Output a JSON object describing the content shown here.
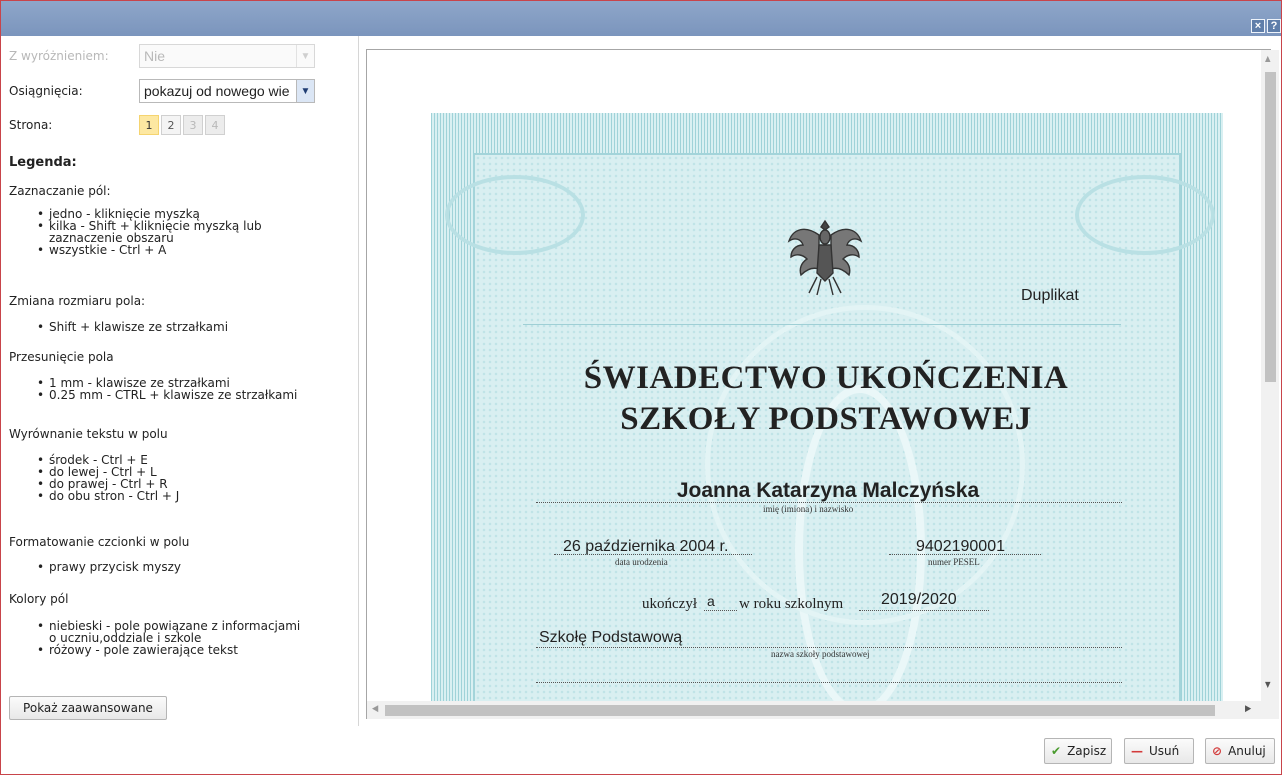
{
  "window": {
    "close_label": "×",
    "help_label": "?"
  },
  "form": {
    "wyroznienie": {
      "label": "Z wyróżnieniem:",
      "value": "Nie"
    },
    "osiagniecia": {
      "label": "Osiągnięcia:",
      "value": "pokazuj od nowego wie"
    },
    "strona": {
      "label": "Strona:",
      "pages": [
        "1",
        "2",
        "3",
        "4"
      ],
      "active_page": "1"
    }
  },
  "legend": {
    "title": "Legenda:",
    "sections": [
      {
        "heading": "Zaznaczanie pól:",
        "items": [
          "jedno - kliknięcie myszką",
          "kilka - Shift + kliknięcie myszką lub",
          "zaznaczenie obszaru",
          "wszystkie - Ctrl + A"
        ]
      },
      {
        "heading": "Zmiana rozmiaru pola:",
        "items": [
          "Shift + klawisze ze strzałkami"
        ]
      },
      {
        "heading": "Przesunięcie pola",
        "items": [
          "1 mm - klawisze ze strzałkami",
          "0.25 mm - CTRL + klawisze ze strzałkami"
        ]
      },
      {
        "heading": "Wyrównanie tekstu w polu",
        "items": [
          "środek - Ctrl + E",
          "do lewej - Ctrl + L",
          "do prawej - Ctrl + R",
          "do obu stron - Ctrl + J"
        ]
      },
      {
        "heading": "Formatowanie czcionki w polu",
        "items": [
          "prawy przycisk myszy"
        ]
      },
      {
        "heading": "Kolory pól",
        "items": [
          "niebieski - pole powiązane z informacjami",
          "o uczniu,oddziale i szkole",
          "różowy - pole zawierające tekst"
        ]
      }
    ],
    "advanced_button": "Pokaż zaawansowane"
  },
  "certificate": {
    "duplicate_label": "Duplikat",
    "title_line1": "ŚWIADECTWO UKOŃCZENIA",
    "title_line2": "SZKOŁY PODSTAWOWEJ",
    "student_name": "Joanna Katarzyna Malczyńska",
    "name_caption": "imię (imiona) i nazwisko",
    "birth_date": "26 października 2004 r.",
    "birth_caption": "data urodzenia",
    "pesel": "9402190001",
    "pesel_caption": "numer PESEL",
    "completed_prefix": "ukończył",
    "completed_suffix": "a",
    "school_year_label": "w roku szkolnym",
    "school_year": "2019/2020",
    "school_name": "Szkołę Podstawową",
    "school_caption": "nazwa szkoły podstawowej"
  },
  "footer": {
    "save_label": "Zapisz",
    "delete_label": "Usuń",
    "cancel_label": "Anuluj"
  },
  "colors": {
    "titlebar": "#7b95bd",
    "certificate_bg": "#cde9ec",
    "active_page": "#fde8a2",
    "save_icon": "#4a9b2e",
    "delete_icon": "#d33b3b"
  }
}
